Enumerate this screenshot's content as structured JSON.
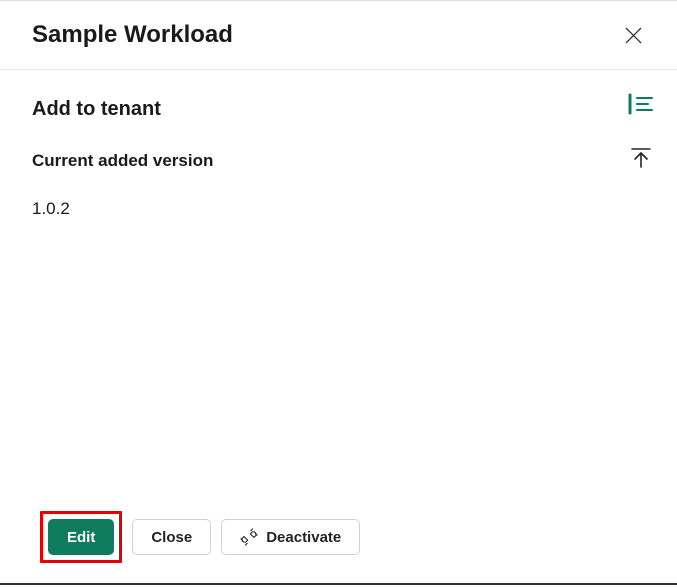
{
  "header": {
    "title": "Sample Workload"
  },
  "main": {
    "section_title": "Add to tenant",
    "version_label": "Current added version",
    "version_value": "1.0.2"
  },
  "footer": {
    "edit_label": "Edit",
    "close_label": "Close",
    "deactivate_label": "Deactivate"
  }
}
